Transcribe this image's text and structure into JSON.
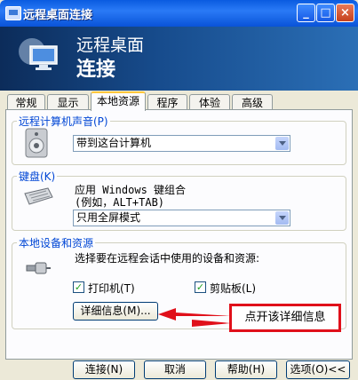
{
  "window": {
    "title": "远程桌面连接",
    "minimize": "_",
    "maximize": "□",
    "close": "×"
  },
  "banner": {
    "line1": "远程桌面",
    "line2": "连接"
  },
  "tabs": [
    "常规",
    "显示",
    "本地资源",
    "程序",
    "体验",
    "高级"
  ],
  "active_tab": "本地资源",
  "sound": {
    "group": "远程计算机声音(P)",
    "selected": "带到这台计算机"
  },
  "keyboard": {
    "group": "键盘(K)",
    "line1": "应用 Windows 键组合",
    "line2": "(例如，ALT+TAB)",
    "selected": "只用全屏模式"
  },
  "devices": {
    "group": "本地设备和资源",
    "desc": "选择要在远程会话中使用的设备和资源:",
    "printer": "打印机(T)",
    "clipboard": "剪贴板(L)",
    "details_button": "详细信息(M)..."
  },
  "annotation": "点开该详细信息",
  "buttons": {
    "connect": "连接(N)",
    "cancel": "取消",
    "help": "帮助(H)",
    "options": "选项(O)<<"
  }
}
